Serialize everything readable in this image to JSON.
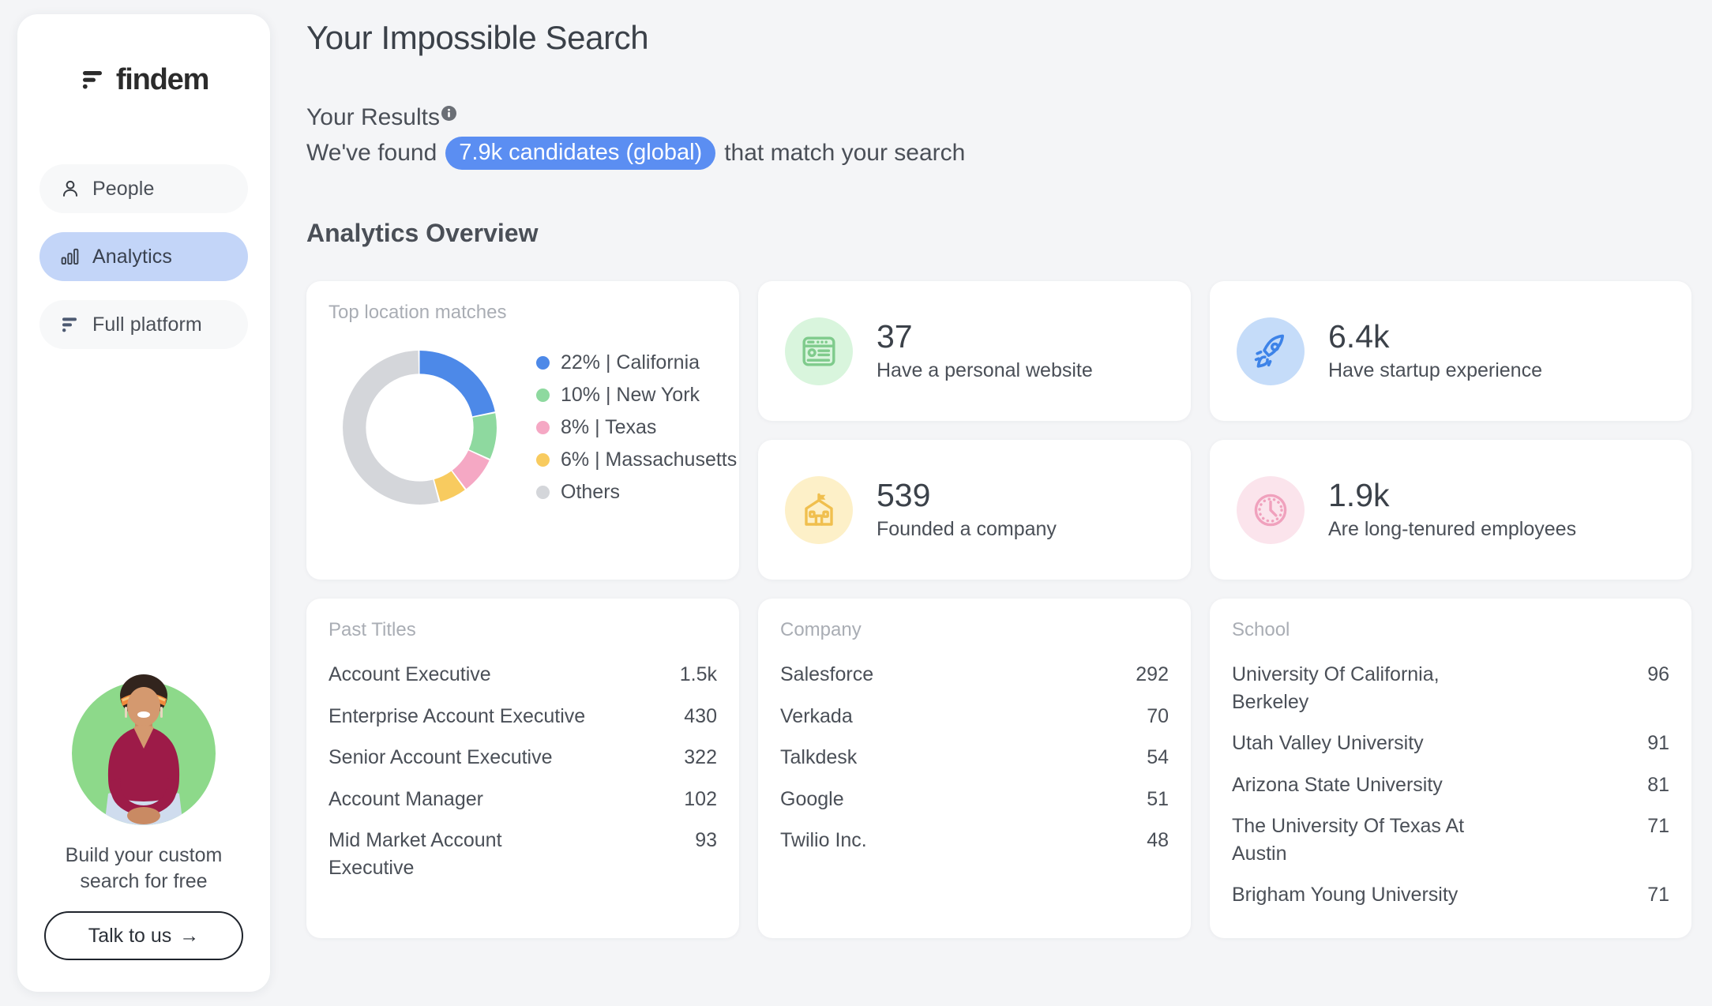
{
  "sidebar": {
    "logo_text": "findem",
    "nav": [
      {
        "label": "People",
        "icon": "person-icon",
        "active": false
      },
      {
        "label": "Analytics",
        "icon": "bar-chart-icon",
        "active": true
      },
      {
        "label": "Full platform",
        "icon": "lines-icon",
        "active": false
      }
    ],
    "cta": {
      "line1": "Build your custom",
      "line2": "search for free",
      "button_label": "Talk to us",
      "button_arrow": "→"
    }
  },
  "header": {
    "title": "Your Impossible Search",
    "results_label": "Your Results",
    "info_icon": "info-icon",
    "found_prefix": "We've found",
    "count_pill": "7.9k candidates (global)",
    "found_suffix": "that match your search",
    "pill_color": "#5b8ef2"
  },
  "section": {
    "title": "Analytics Overview"
  },
  "chart_data": {
    "type": "pie",
    "title": "Top location matches",
    "legend_position": "right",
    "categories": [
      "California",
      "New York",
      "Texas",
      "Massachusetts",
      "Others"
    ],
    "values": [
      22,
      10,
      8,
      6,
      54
    ],
    "colors": [
      "#4d89e8",
      "#8ed99f",
      "#f5a8c4",
      "#f8cb5f",
      "#d4d6da"
    ],
    "legend": [
      {
        "label": "22% | California",
        "color": "#4d89e8"
      },
      {
        "label": "10% | New York",
        "color": "#8ed99f"
      },
      {
        "label": "8% | Texas",
        "color": "#f5a8c4"
      },
      {
        "label": "6% | Massachusetts",
        "color": "#f8cb5f"
      },
      {
        "label": "Others",
        "color": "#d4d6da"
      }
    ]
  },
  "stats": [
    {
      "value": "37",
      "label": "Have a personal website",
      "icon": "website-card-icon",
      "bg": "#d9f5dd",
      "fg": "#7fcb8c"
    },
    {
      "value": "6.4k",
      "label": "Have startup experience",
      "icon": "rocket-icon",
      "bg": "#c5dcf9",
      "fg": "#3d83e8"
    },
    {
      "value": "539",
      "label": "Founded a company",
      "icon": "building-flag-icon",
      "bg": "#fdf0c8",
      "fg": "#f7ca5a"
    },
    {
      "value": "1.9k",
      "label": "Are long-tenured employees",
      "icon": "clock-icon",
      "bg": "#fbe4ec",
      "fg": "#f0a1bd"
    }
  ],
  "lists": [
    {
      "title": "Past Titles",
      "rows": [
        {
          "name": "Account Executive",
          "value": "1.5k"
        },
        {
          "name": "Enterprise Account Executive",
          "value": "430"
        },
        {
          "name": "Senior Account Executive",
          "value": "322"
        },
        {
          "name": "Account Manager",
          "value": "102"
        },
        {
          "name": "Mid Market Account Executive",
          "value": "93"
        }
      ]
    },
    {
      "title": "Company",
      "rows": [
        {
          "name": "Salesforce",
          "value": "292"
        },
        {
          "name": "Verkada",
          "value": "70"
        },
        {
          "name": "Talkdesk",
          "value": "54"
        },
        {
          "name": "Google",
          "value": "51"
        },
        {
          "name": "Twilio Inc.",
          "value": "48"
        }
      ]
    },
    {
      "title": "School",
      "rows": [
        {
          "name": "University Of California, Berkeley",
          "value": "96"
        },
        {
          "name": "Utah Valley University",
          "value": "91"
        },
        {
          "name": "Arizona State University",
          "value": "81"
        },
        {
          "name": "The University Of Texas At Austin",
          "value": "71"
        },
        {
          "name": "Brigham Young University",
          "value": "71"
        }
      ]
    }
  ]
}
